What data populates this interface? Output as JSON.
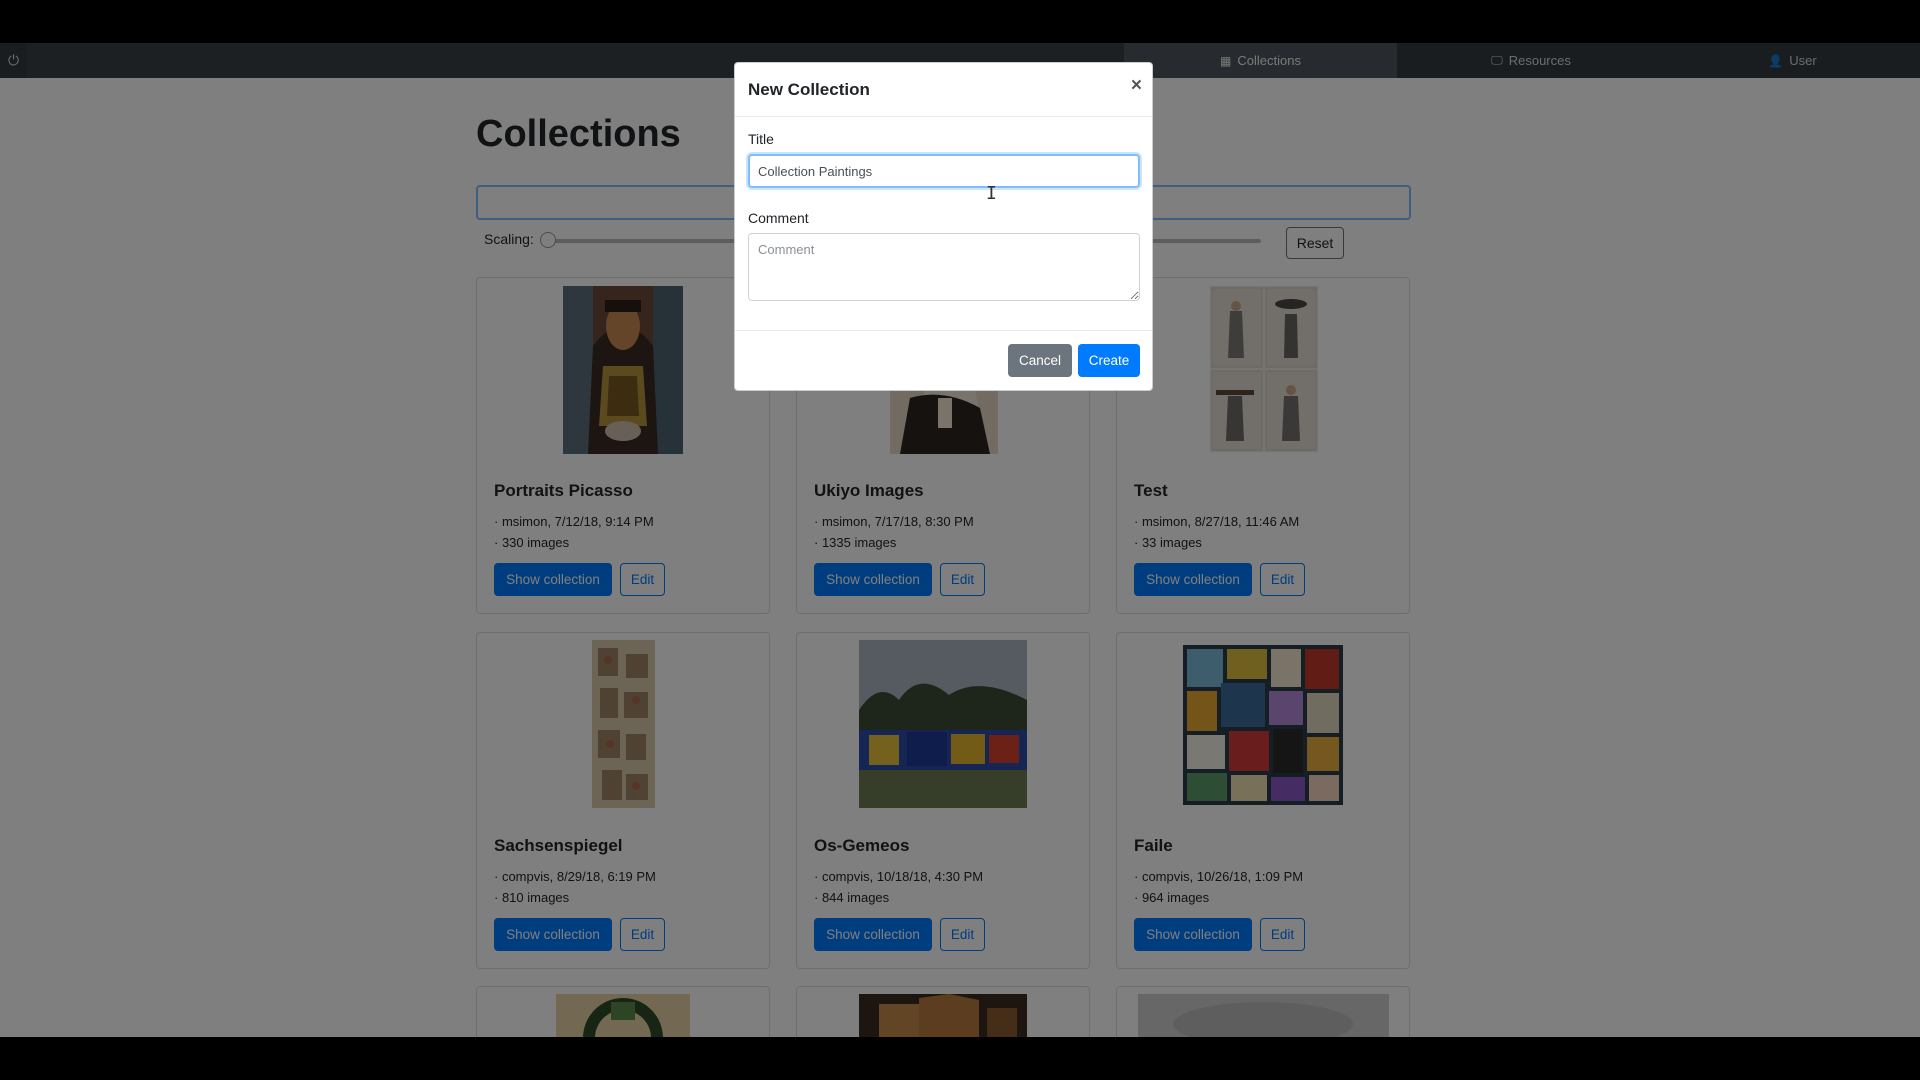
{
  "nav": {
    "items": [
      {
        "label": "Collections",
        "icon": "grid-icon"
      },
      {
        "label": "Resources",
        "icon": "monitor-icon"
      },
      {
        "label": "User",
        "icon": "user-icon"
      }
    ]
  },
  "page": {
    "title": "Collections",
    "scaling_label": "Scaling:",
    "reset_label": "Reset"
  },
  "cards": [
    {
      "title": "Portraits Picasso",
      "meta1": "· msimon, 7/12/18, 9:14 PM",
      "meta2": "· 330 images",
      "show": "Show collection",
      "edit": "Edit"
    },
    {
      "title": "Ukiyo Images",
      "meta1": "· msimon, 7/17/18, 8:30 PM",
      "meta2": "· 1335 images",
      "show": "Show collection",
      "edit": "Edit"
    },
    {
      "title": "Test",
      "meta1": "· msimon, 8/27/18, 11:46 AM",
      "meta2": "· 33 images",
      "show": "Show collection",
      "edit": "Edit"
    },
    {
      "title": "Sachsenspiegel",
      "meta1": "· compvis, 8/29/18, 6:19 PM",
      "meta2": "· 810 images",
      "show": "Show collection",
      "edit": "Edit"
    },
    {
      "title": "Os-Gemeos",
      "meta1": "· compvis, 10/18/18, 4:30 PM",
      "meta2": "· 844 images",
      "show": "Show collection",
      "edit": "Edit"
    },
    {
      "title": "Faile",
      "meta1": "· compvis, 10/26/18, 1:09 PM",
      "meta2": "· 964 images",
      "show": "Show collection",
      "edit": "Edit"
    }
  ],
  "modal": {
    "title": "New Collection",
    "close": "×",
    "title_label": "Title",
    "title_value": "Collection Paintings",
    "comment_label": "Comment",
    "comment_placeholder": "Comment",
    "cancel": "Cancel",
    "create": "Create"
  },
  "colors": {
    "primary": "#007bff",
    "secondary": "#6c757d",
    "navbar": "#343a40"
  }
}
